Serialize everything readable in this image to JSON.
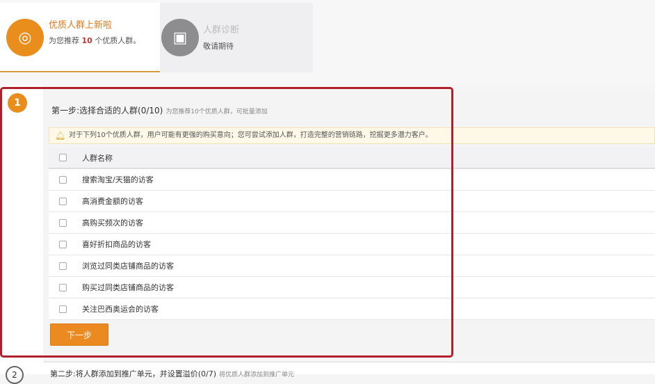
{
  "cards": [
    {
      "title": "优质人群上新啦",
      "desc_pre": "为您推荐",
      "count": "10",
      "desc_post": "个优质人群。",
      "icon": "fingerprint-icon"
    },
    {
      "title": "人群诊断",
      "desc": "敬请期待",
      "icon": "diagnosis-icon"
    }
  ],
  "step1": {
    "number": "1",
    "title": "第一步:选择合适的人群(0/10)",
    "subtitle": "为您推荐10个优质人群，可批量添加",
    "notice": "对于下列10个优质人群，用户可能有更强的购买意向；您可尝试添加人群，打造完整的营销链路，挖掘更多潜力客户。",
    "column_header": "人群名称",
    "rows": [
      "搜索淘宝/天猫的访客",
      "高消费金额的访客",
      "高购买频次的访客",
      "喜好折扣商品的访客",
      "浏览过同类店铺商品的访客",
      "购买过同类店铺商品的访客",
      "关注巴西奥运会的访客"
    ],
    "next_label": "下一步"
  },
  "step2": {
    "number": "2",
    "title": "第二步:将人群添加到推广单元，并设置溢价(0/7)",
    "subtitle": "将优质人群添加到推广单元"
  },
  "colors": {
    "accent": "#e98d1d",
    "highlight": "#b0202a"
  }
}
